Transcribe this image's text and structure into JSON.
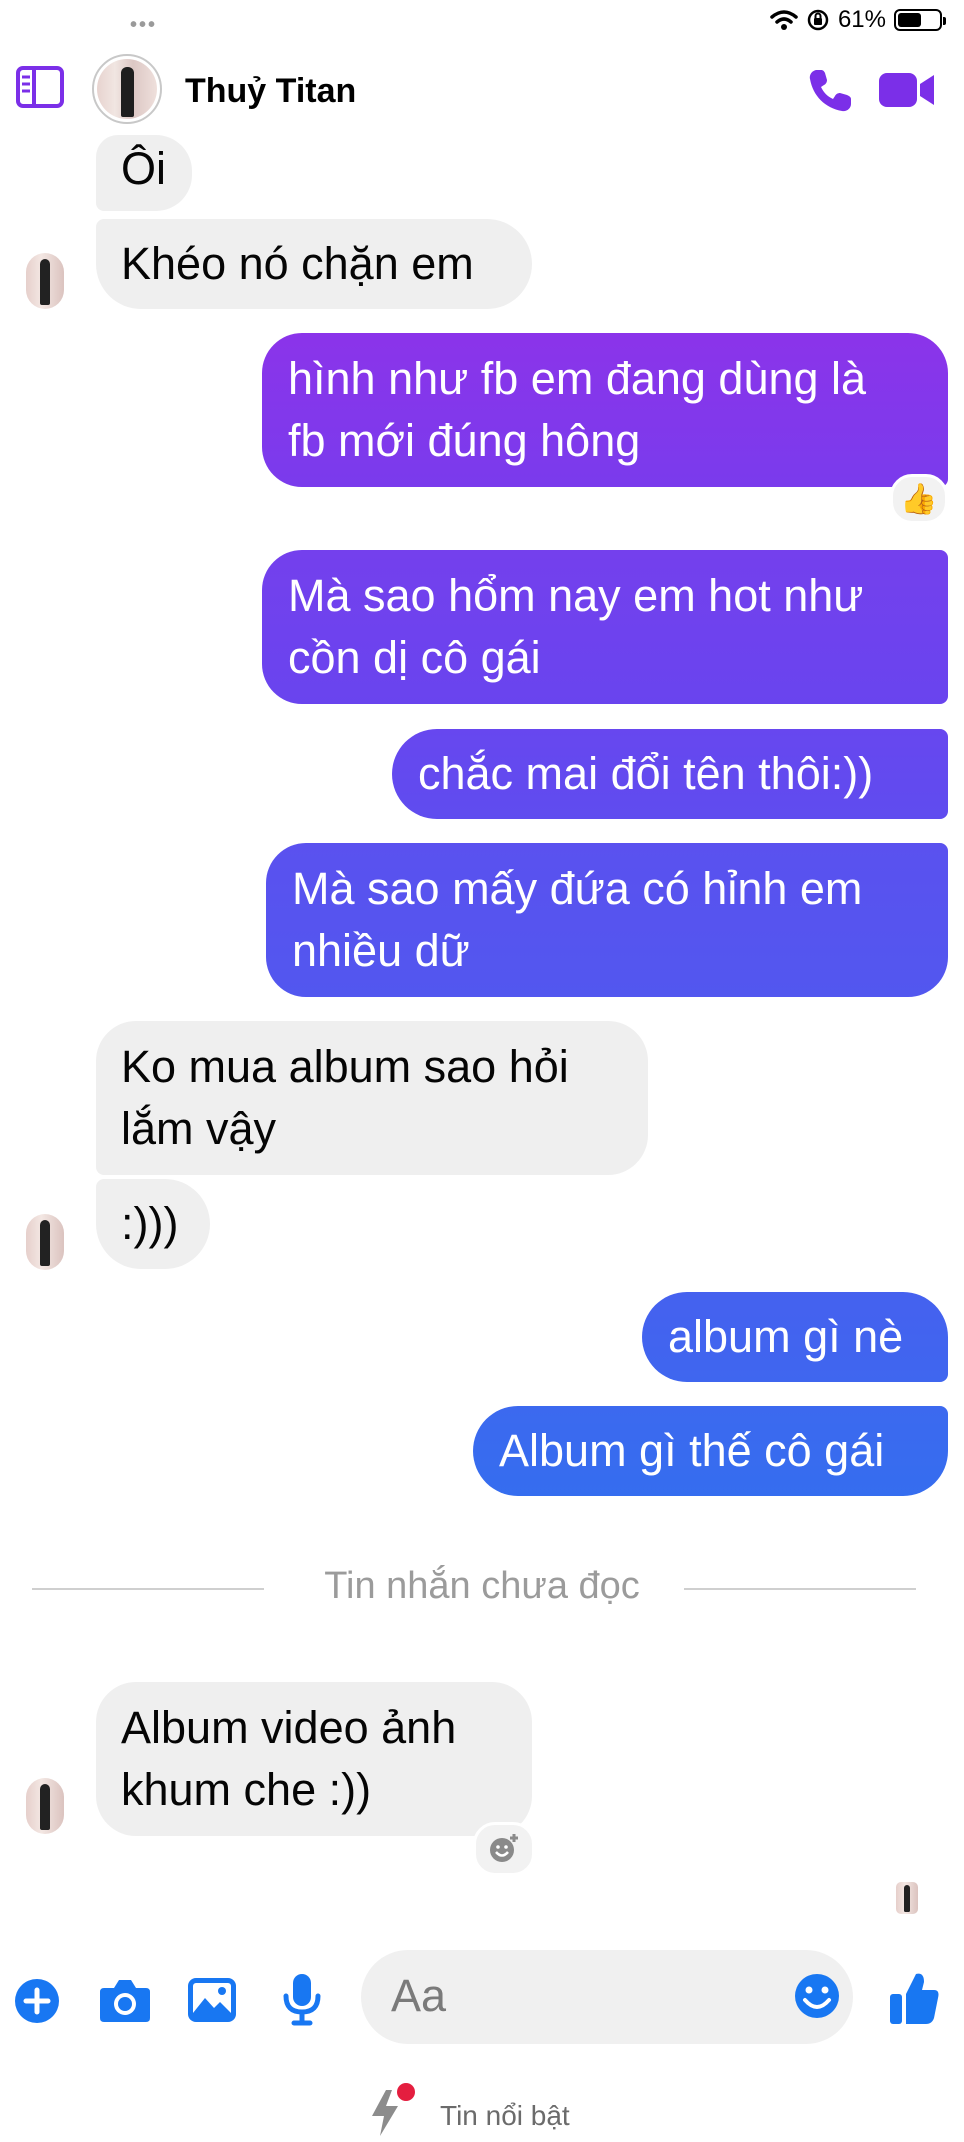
{
  "status_bar": {
    "battery": "61%",
    "battery_level": 0.61,
    "icons": [
      "wifi-icon",
      "orientation-lock-icon",
      "battery-icon"
    ]
  },
  "header": {
    "contact_name": "Thuỷ Titan",
    "icons": [
      "sidebar-icon",
      "phone-icon",
      "video-call-icon"
    ]
  },
  "colors": {
    "accent": "#7b2fe8",
    "received_bubble": "#efefef",
    "sent_gradient_top": "#8a33ea",
    "sent_gradient_bottom": "#2f63ee"
  },
  "messages": [
    {
      "side": "received",
      "text": "Ôi"
    },
    {
      "side": "received",
      "text": "Khéo nó chặn em"
    },
    {
      "side": "sent",
      "lines": [
        "hình như fb em đang dùng là",
        "fb mới đúng hông"
      ],
      "reaction": "👍"
    },
    {
      "side": "sent",
      "lines": [
        "Mà sao hổm nay em hot như",
        "cồn dị cô gái"
      ]
    },
    {
      "side": "sent",
      "text": "chắc mai đổi tên thôi:))"
    },
    {
      "side": "sent",
      "lines": [
        "Mà sao mấy đứa có hỉnh em",
        "nhiều dữ"
      ]
    },
    {
      "side": "received",
      "lines": [
        "Ko mua album sao hỏi",
        "lắm vậy"
      ]
    },
    {
      "side": "received",
      "text": ":)))"
    },
    {
      "side": "sent",
      "text": "album gì nè"
    },
    {
      "side": "sent",
      "text": "Album gì thế cô gái"
    },
    {
      "side": "received",
      "lines": [
        "Album video ảnh",
        "khum che :))"
      ],
      "reaction_icon": "add-reaction-icon"
    }
  ],
  "divider": {
    "label": "Tin nhắn chưa đọc"
  },
  "composer": {
    "placeholder": "Aa",
    "icons": [
      "plus-icon",
      "camera-icon",
      "gallery-icon",
      "microphone-icon",
      "emoji-icon",
      "like-icon"
    ]
  },
  "highlights": {
    "label": "Tin nổi bật",
    "icon": "lightning-icon"
  }
}
